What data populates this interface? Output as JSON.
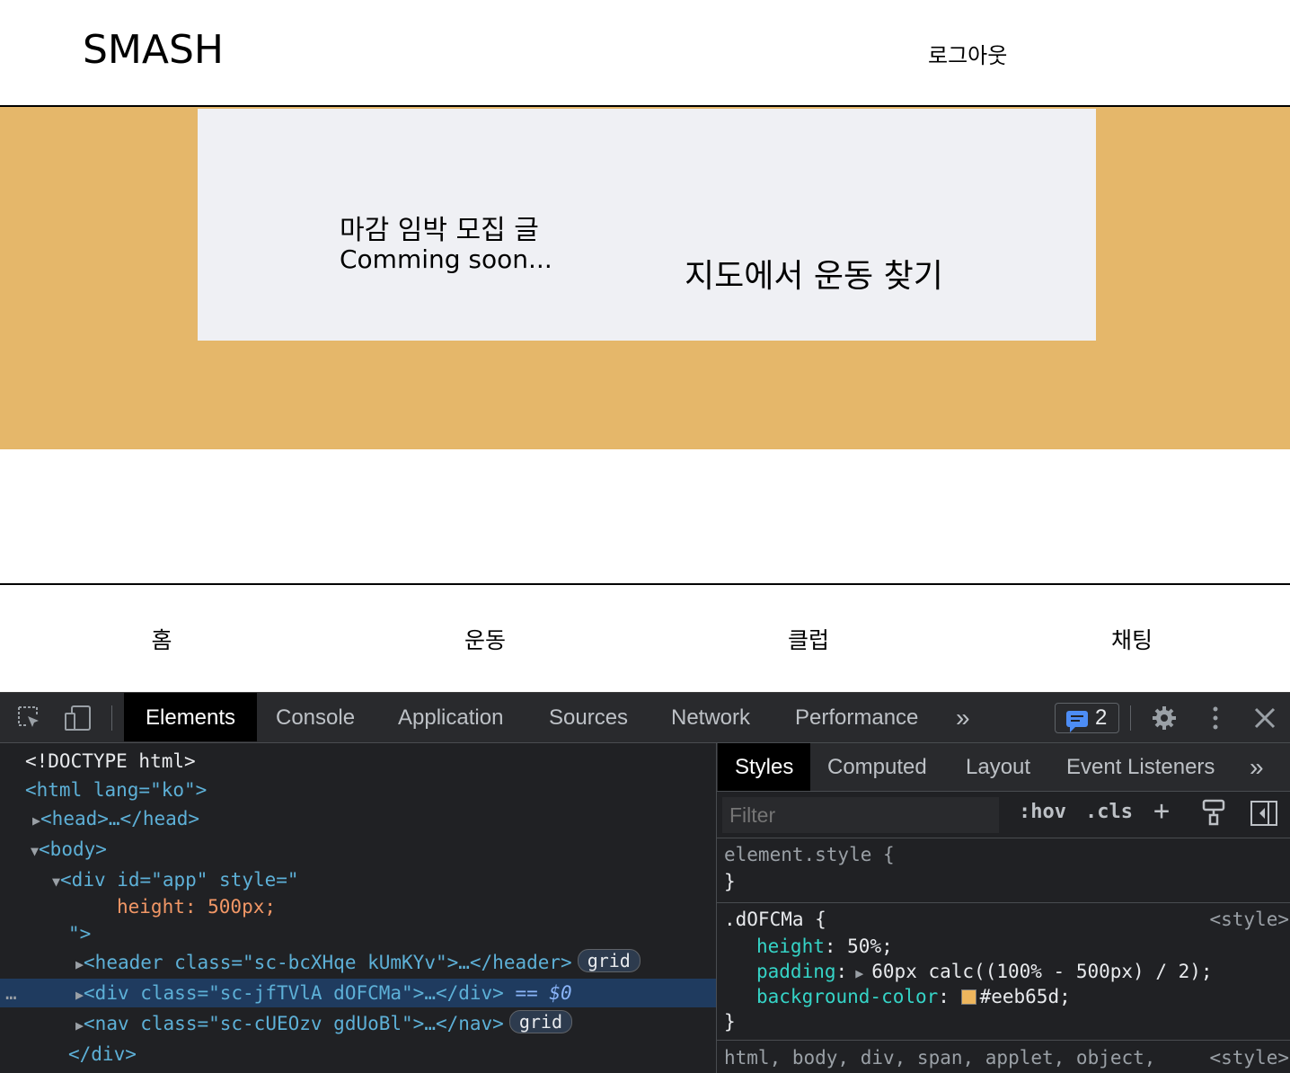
{
  "site": {
    "logo": "SMASH",
    "logout": "로그아웃"
  },
  "banner": {
    "deadline_title": "마감 임박 모집 글",
    "deadline_sub": "Comming soon...",
    "map_find": "지도에서 운동 찾기",
    "background_color": "#e5b76a",
    "card_color": "#eff0f4"
  },
  "bottom_nav": {
    "items": [
      "홈",
      "운동",
      "클럽",
      "채팅"
    ]
  },
  "devtools": {
    "tabs": [
      "Elements",
      "Console",
      "Application",
      "Sources",
      "Network",
      "Performance"
    ],
    "active_tab": "Elements",
    "more_tabs": "»",
    "issues_count": "2",
    "icons": [
      "inspect-element-icon",
      "device-toolbar-icon",
      "settings-gear-icon",
      "more-vert-icon",
      "close-icon"
    ],
    "dom": {
      "doctype": "<!DOCTYPE html>",
      "html_open": "<html lang=\"ko\">",
      "head": "<head>…</head>",
      "body_open": "<body>",
      "app_open": "<div id=\"app\" style=\"",
      "app_style": "height: 500px;",
      "app_close": "\">",
      "header": "<header class=\"sc-bcXHqe kUmKYv\">…</header>",
      "div_selected": "<div class=\"sc-jfTVlA dOFCMa\">…</div>",
      "selected_ref": "== $0",
      "nav": "<nav class=\"sc-cUEOzv gdUoBl\">…</nav>",
      "div_close": "</div>",
      "grid_badge": "grid",
      "dots": "…"
    },
    "styles": {
      "tabs": [
        "Styles",
        "Computed",
        "Layout",
        "Event Listeners"
      ],
      "active_tab": "Styles",
      "filter_placeholder": "Filter",
      "hov": ":hov",
      "cls": ".cls",
      "element_style": "element.style {",
      "close_brace": "}",
      "rule_selector": ".dOFCMa {",
      "rule_source": "<style>",
      "declarations": [
        {
          "prop": "height",
          "value": "50%;"
        },
        {
          "prop": "padding",
          "value": "60px calc((100% - 500px) / 2);"
        },
        {
          "prop": "background-color",
          "value": "#eeb65d;"
        }
      ],
      "inherited_selector": "html, body, div, span, applet, object,",
      "inherited_source": "<style>",
      "swatch_color": "#eeb65d"
    }
  }
}
